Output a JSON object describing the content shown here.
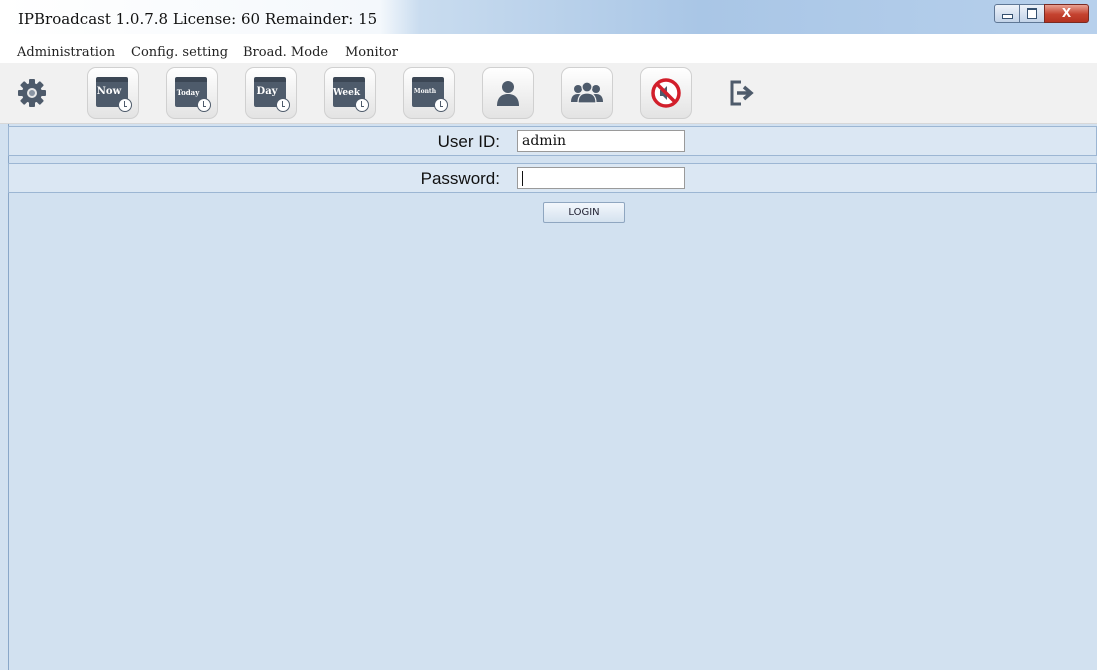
{
  "window": {
    "title": "IPBroadcast 1.0.7.8 License: 60 Remainder: 15",
    "controls": {
      "close_glyph": "X"
    }
  },
  "menu": [
    {
      "label": "Administration"
    },
    {
      "label": "Config. setting"
    },
    {
      "label": "Broad. Mode"
    },
    {
      "label": "Monitor"
    }
  ],
  "toolbar": {
    "buttons": [
      {
        "icon": "gear-icon"
      },
      {
        "icon": "calendar-now-icon",
        "label": "Now"
      },
      {
        "icon": "calendar-today-icon",
        "label": "Today"
      },
      {
        "icon": "calendar-day-icon",
        "label": "Day"
      },
      {
        "icon": "calendar-week-icon",
        "label": "Week"
      },
      {
        "icon": "calendar-month-icon",
        "label": "Month"
      },
      {
        "icon": "user-icon"
      },
      {
        "icon": "user-group-icon"
      },
      {
        "icon": "mute-icon"
      },
      {
        "icon": "logout-icon"
      }
    ]
  },
  "login": {
    "user_id_label": "User ID:",
    "user_id_value": "admin",
    "password_label": "Password:",
    "password_value": "",
    "button_label": "LOGIN"
  },
  "colors": {
    "background": "#d2e1f0",
    "gear": "#4e5b6b",
    "mute_red": "#d21f2b"
  }
}
